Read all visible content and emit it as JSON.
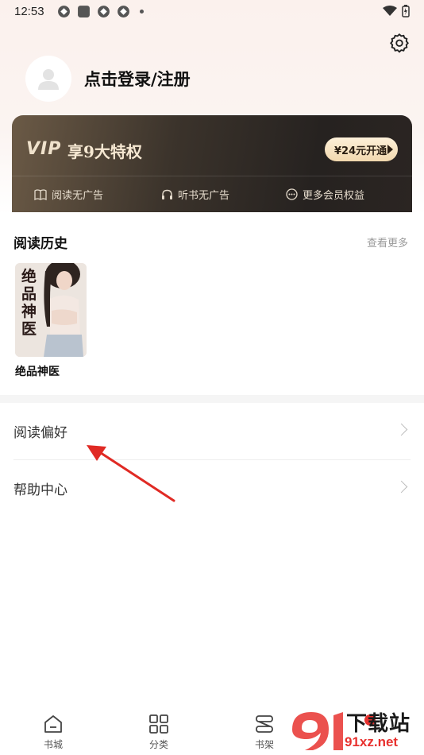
{
  "status_bar": {
    "time": "12:53"
  },
  "profile": {
    "login_text": "点击登录/注册"
  },
  "vip": {
    "logo": "VIP",
    "title": "享9大特权",
    "button": "¥24元开通",
    "perks": [
      "阅读无广告",
      "听书无广告",
      "更多会员权益"
    ],
    "colors": {
      "card": "#2b2522",
      "accent": "#f2d8ae"
    }
  },
  "history": {
    "title": "阅读历史",
    "see_more": "查看更多",
    "books": [
      {
        "name": "绝品神医",
        "cover_text": "绝品神医"
      }
    ]
  },
  "menu": {
    "items": [
      {
        "label": "阅读偏好"
      },
      {
        "label": "帮助中心"
      }
    ]
  },
  "tabbar": {
    "tabs": [
      {
        "label": "书城",
        "icon": "home-icon"
      },
      {
        "label": "分类",
        "icon": "grid-icon"
      },
      {
        "label": "书架",
        "icon": "shelf-icon"
      }
    ]
  },
  "watermark": {
    "brand": "下载站",
    "site": "91xz.net"
  }
}
